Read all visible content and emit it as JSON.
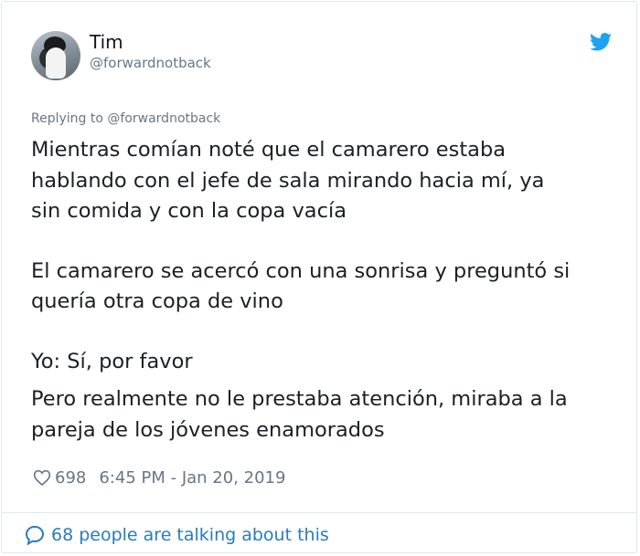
{
  "author": {
    "display_name": "Tim",
    "handle": "@forwardnotback",
    "avatar_icon": "penguin-avatar"
  },
  "platform_icon": "twitter-bird-icon",
  "reply_context": {
    "prefix": "Replying to ",
    "handle": "@forwardnotback"
  },
  "tweet": {
    "paragraphs": [
      "Mientras comían noté que el camarero estaba\nhablando con el jefe de sala mirando hacia mí, ya\nsin comida y con la copa vacía",
      "El camarero se acercó con una sonrisa y preguntó si\nquería otra copa de vino",
      "Yo: Sí, por favor",
      "Pero realmente no le prestaba atención, miraba a la\npareja de los jóvenes enamorados"
    ]
  },
  "meta": {
    "likes": "698",
    "timestamp": "6:45 PM - Jan 20, 2019"
  },
  "footer": {
    "talking": "68 people are talking about this"
  },
  "colors": {
    "accent": "#1da1f2",
    "link": "#2b7bb9",
    "muted": "#657786",
    "text": "#1c2022",
    "border": "#e1e8ed"
  }
}
